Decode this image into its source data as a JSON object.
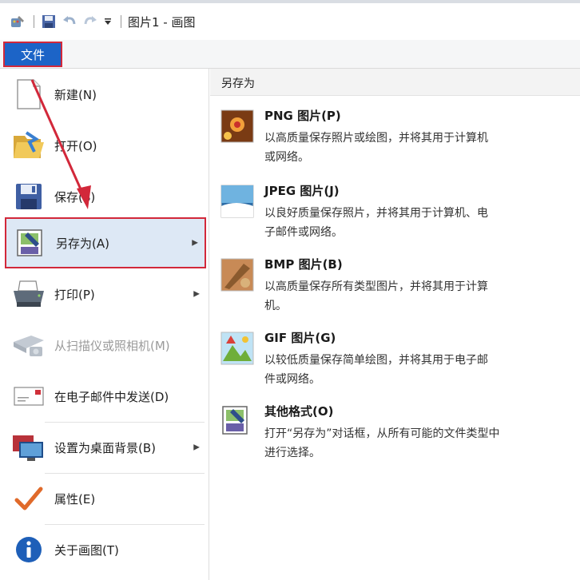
{
  "window": {
    "title": "图片1 - 画图"
  },
  "ribbon": {
    "file_tab": "文件"
  },
  "menu": {
    "items": [
      {
        "label": "新建(N)",
        "icon": "new-document-icon",
        "has_submenu": false,
        "disabled": false
      },
      {
        "label": "打开(O)",
        "icon": "open-folder-icon",
        "has_submenu": false,
        "disabled": false
      },
      {
        "label": "保存(S)",
        "icon": "save-disk-icon",
        "has_submenu": false,
        "disabled": false
      },
      {
        "label": "另存为(A)",
        "icon": "save-as-icon",
        "has_submenu": true,
        "disabled": false,
        "active": true
      },
      {
        "label": "打印(P)",
        "icon": "printer-icon",
        "has_submenu": true,
        "disabled": false
      },
      {
        "label": "从扫描仪或照相机(M)",
        "icon": "scanner-icon",
        "has_submenu": false,
        "disabled": true
      },
      {
        "label": "在电子邮件中发送(D)",
        "icon": "email-icon",
        "has_submenu": false,
        "disabled": false
      },
      {
        "label": "设置为桌面背景(B)",
        "icon": "desktop-background-icon",
        "has_submenu": true,
        "disabled": false
      },
      {
        "label": "属性(E)",
        "icon": "checkmark-icon",
        "has_submenu": false,
        "disabled": false
      },
      {
        "label": "关于画图(T)",
        "icon": "info-icon",
        "has_submenu": false,
        "disabled": false
      }
    ]
  },
  "panel": {
    "header": "另存为",
    "options": [
      {
        "title": "PNG 图片(P)",
        "desc1": "以高质量保存照片或绘图，并将其用于计算机",
        "desc2": "或网络。",
        "icon": "png-image-icon"
      },
      {
        "title": "JPEG 图片(J)",
        "desc1": "以良好质量保存照片，并将其用于计算机、电",
        "desc2": "子邮件或网络。",
        "icon": "jpeg-image-icon"
      },
      {
        "title": "BMP 图片(B)",
        "desc1": "以高质量保存所有类型图片，并将其用于计算",
        "desc2": "机。",
        "icon": "bmp-image-icon"
      },
      {
        "title": "GIF 图片(G)",
        "desc1": "以较低质量保存简单绘图，并将其用于电子邮",
        "desc2": "件或网络。",
        "icon": "gif-image-icon"
      },
      {
        "title": "其他格式(O)",
        "desc1": "打开“另存为”对话框，从所有可能的文件类型中",
        "desc2": "进行选择。",
        "icon": "other-formats-icon"
      }
    ]
  },
  "colors": {
    "file_tab": "#1c64c7",
    "highlight_border": "#d2283a",
    "active_item_bg": "#dde8f5"
  }
}
